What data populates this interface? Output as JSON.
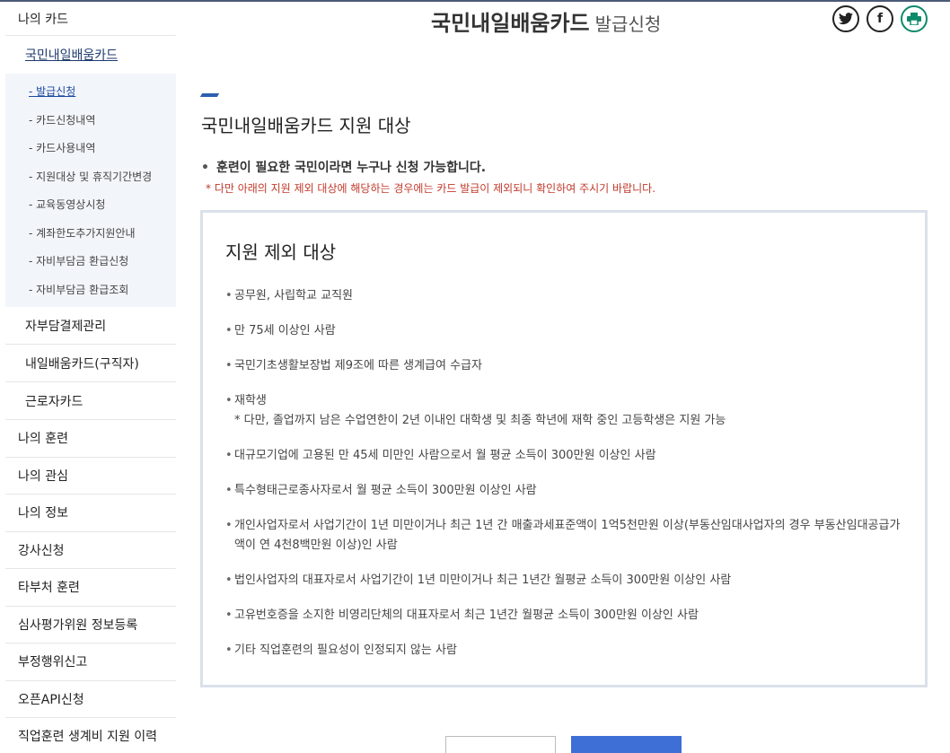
{
  "header": {
    "title": "국민내일배움카드",
    "subtitle": "발급신청"
  },
  "social": {
    "twitter": "twitter-icon",
    "facebook": "facebook-icon",
    "print": "print-icon"
  },
  "sidebar": {
    "top": "나의 카드",
    "sub1": "국민내일배움카드",
    "subsub": [
      "- 발급신청",
      "- 카드신청내역",
      "- 카드사용내역",
      "- 지원대상 및 휴직기간변경",
      "- 교육동영상시청",
      "- 계좌한도추가지원안내",
      "- 자비부담금 환급신청",
      "- 자비부담금 환급조회"
    ],
    "sub2": "자부담결제관리",
    "sub3": "내일배움카드(구직자)",
    "sub4": "근로자카드",
    "main": [
      "나의 훈련",
      "나의 관심",
      "나의 정보",
      "강사신청",
      "타부처 훈련",
      "심사평가위원 정보등록",
      "부정행위신고",
      "오픈API신청",
      "직업훈련 생계비 지원 이력"
    ]
  },
  "content": {
    "section_title": "국민내일배움카드 지원 대상",
    "main_bullet": "훈련이 필요한 국민이라면 누구나 신청 가능합니다.",
    "notice": "* 다만 아래의 지원 제외 대상에 해당하는 경우에는 카드 발급이 제외되니 확인하여 주시기 바랍니다.",
    "box_title": "지원 제외 대상",
    "items": [
      "공무원, 사립학교 교직원",
      "만 75세 이상인 사람",
      "국민기초생활보장법 제9조에 따른 생계급여 수급자",
      "재학생\n* 다만, 졸업까지 남은 수업연한이 2년 이내인 대학생 및 최종 학년에 재학 중인 고등학생은 지원 가능",
      "대규모기업에 고용된 만 45세 미만인 사람으로서 월 평균 소득이 300만원 이상인 사람",
      "특수형태근로종사자로서 월 평균 소득이 300만원 이상인 사람",
      "개인사업자로서 사업기간이 1년 미만이거나 최근 1년 간 매출과세표준액이 1억5천만원 이상(부동산임대사업자의 경우 부동산임대공급가액이 연 4천8백만원 이상)인 사람",
      "법인사업자의 대표자로서 사업기간이 1년 미만이거나 최근 1년간 월평균 소득이 300만원 이상인 사람",
      "고유번호증을 소지한 비영리단체의 대표자로서 최근 1년간 월평균 소득이 300만원 이상인 사람",
      "기타 직업훈련의 필요성이 인정되지 않는 사람"
    ]
  },
  "colors": {
    "accent": "#2a5fb0",
    "notice": "#c0392b",
    "primary_button": "#3d6fd6"
  }
}
